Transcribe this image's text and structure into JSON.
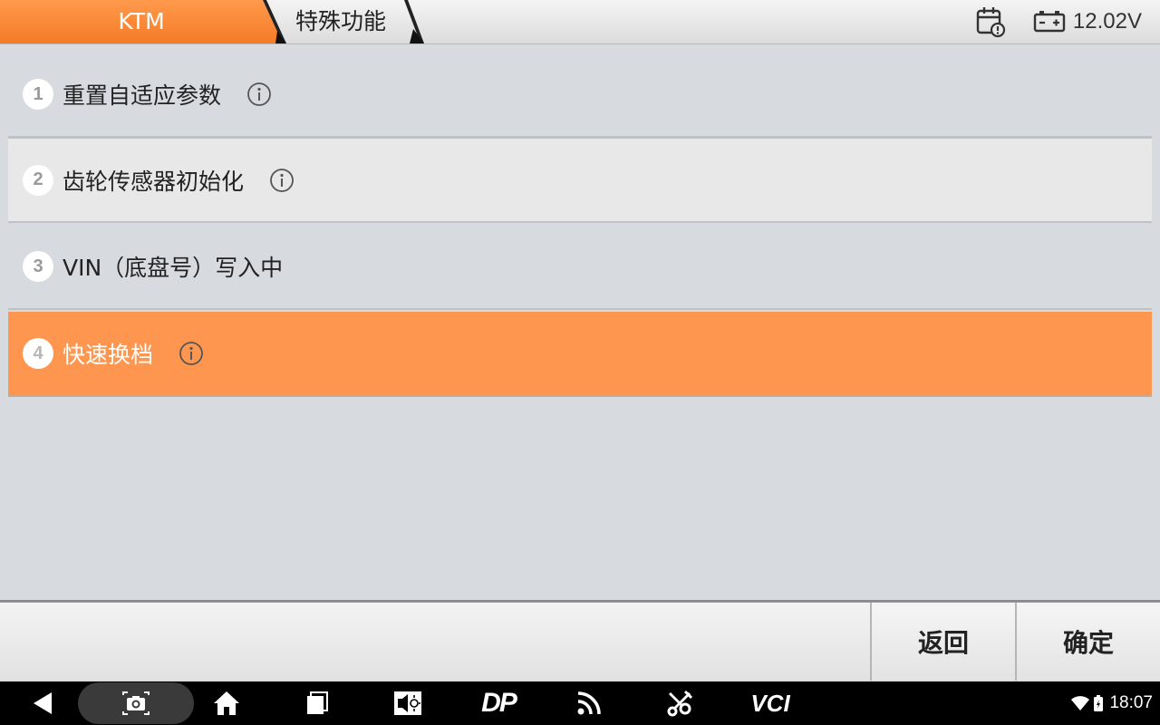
{
  "header": {
    "breadcrumb_home": "KTM",
    "breadcrumb_current": "特殊功能",
    "voltage": "12.02V",
    "icons": [
      "calendar-clock-icon",
      "battery-icon"
    ]
  },
  "list": {
    "items": [
      {
        "number": "1",
        "label": "重置自适应参数",
        "has_info": true
      },
      {
        "number": "2",
        "label": "齿轮传感器初始化",
        "has_info": true
      },
      {
        "number": "3",
        "label": "VIN（底盘号）写入中",
        "has_info": false
      },
      {
        "number": "4",
        "label": "快速换档",
        "has_info": true,
        "selected": true
      }
    ]
  },
  "actions": {
    "back_label": "返回",
    "confirm_label": "确定"
  },
  "navbar": {
    "icons": [
      "back-icon",
      "screenshot-icon",
      "home-icon",
      "recents-icon",
      "brightness-icon",
      "dp-icon",
      "feed-icon",
      "tools-icon",
      "vci-icon"
    ],
    "dp_text": "DP",
    "vci_text": "VCI",
    "time": "18:07"
  },
  "colors": {
    "accent": "#f47a27",
    "selected_row": "#ff9650",
    "background": "#d7dbdf"
  }
}
